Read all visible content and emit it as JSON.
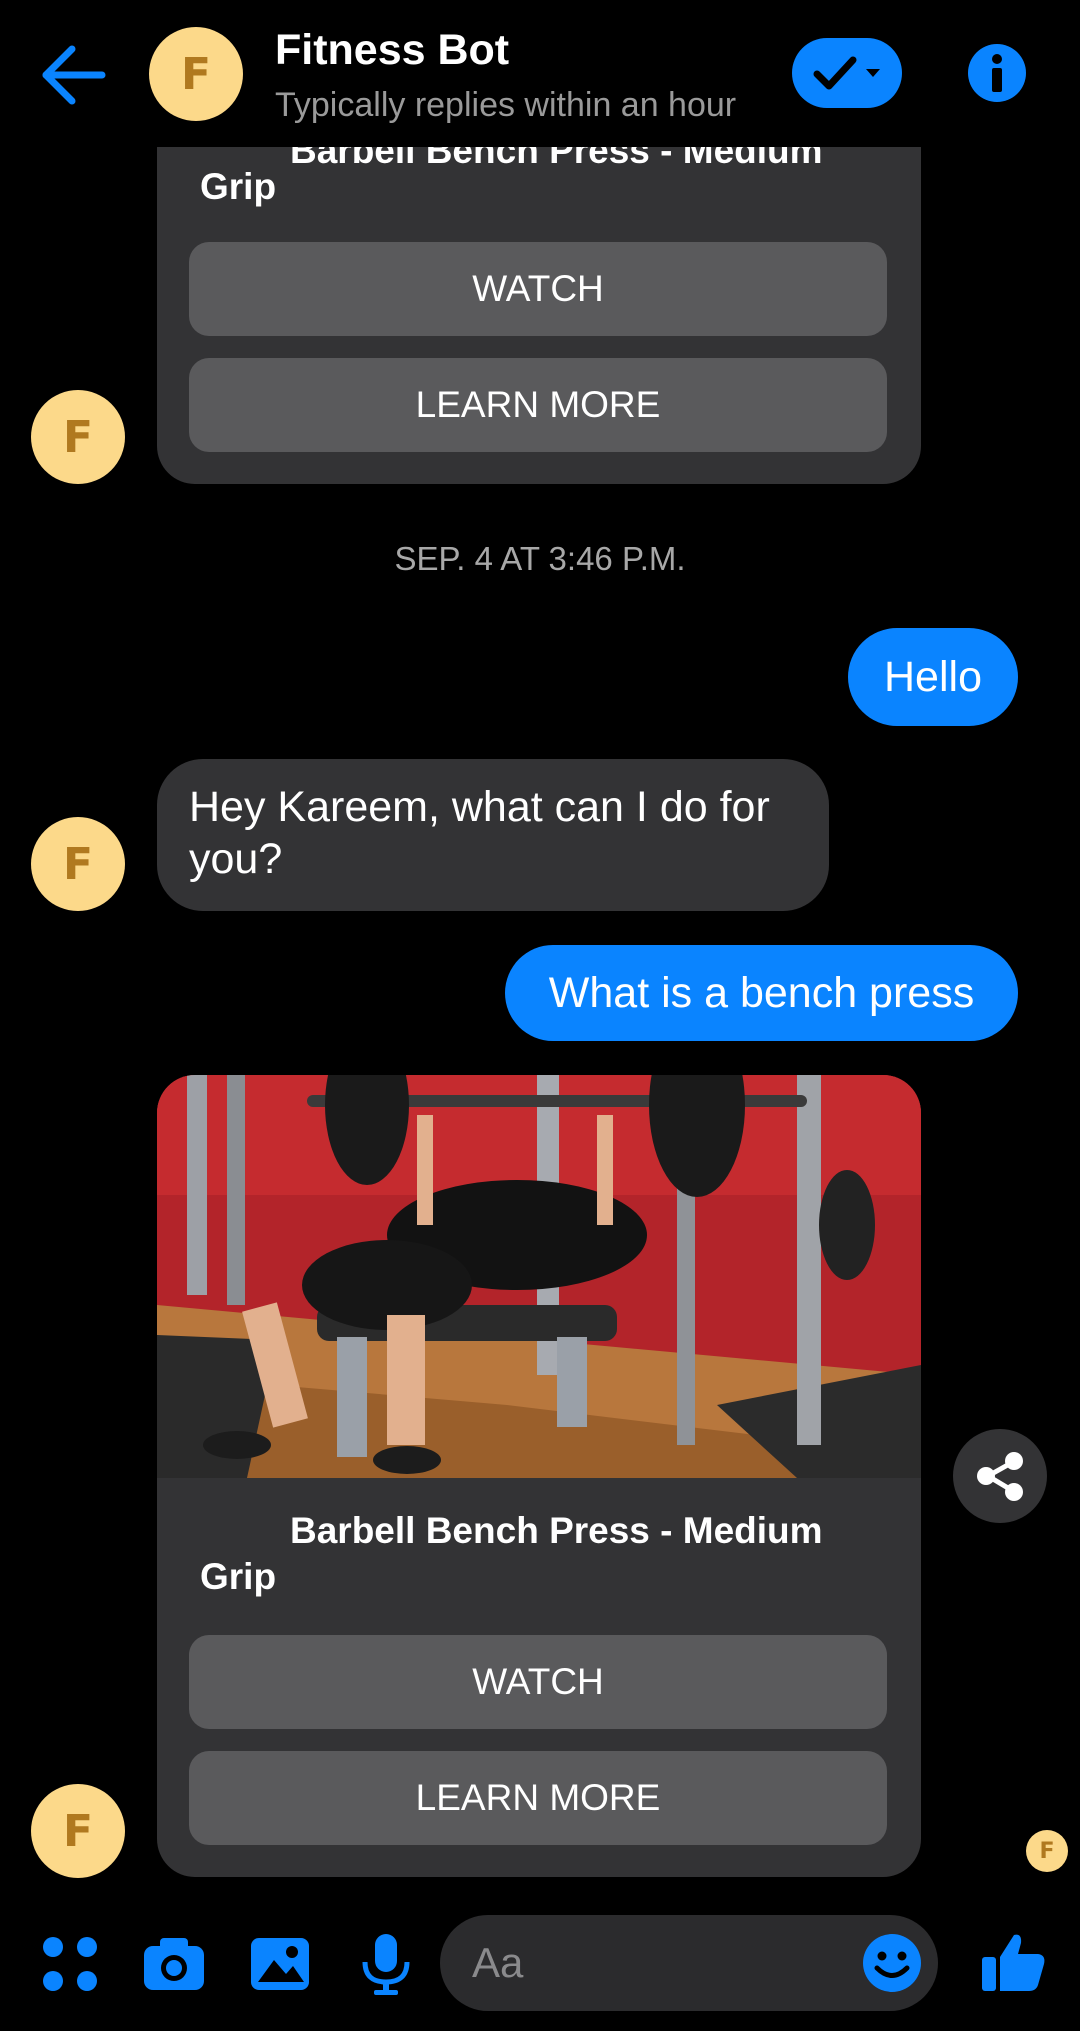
{
  "header": {
    "avatar_letter": "F",
    "title": "Fitness Bot",
    "subtitle": "Typically replies within an hour"
  },
  "messages": {
    "card1": {
      "title_partial": "Barbell Bench Press - Medium",
      "title_tail": "Grip",
      "watch_label": "WATCH",
      "learn_more_label": "LEARN MORE"
    },
    "timestamp": "SEP. 4 AT 3:46 P.M.",
    "out1": "Hello",
    "in1": "Hey Kareem, what can I do for you?",
    "out2": "What is a bench press",
    "card2": {
      "title": "Barbell Bench Press - Medium Grip",
      "watch_label": "WATCH",
      "learn_more_label": "LEARN MORE"
    },
    "bot_avatar_letter": "F"
  },
  "composer": {
    "placeholder": "Aa"
  },
  "colors": {
    "accent": "#0a84ff",
    "bubble_dark": "#333335",
    "avatar_bg": "#fcd98a",
    "avatar_fg": "#b0791f"
  },
  "icons": [
    "back-arrow-icon",
    "check-icon",
    "chevron-down-icon",
    "info-icon",
    "share-icon",
    "apps-icon",
    "camera-icon",
    "image-icon",
    "microphone-icon",
    "emoji-icon",
    "thumbs-up-icon"
  ]
}
